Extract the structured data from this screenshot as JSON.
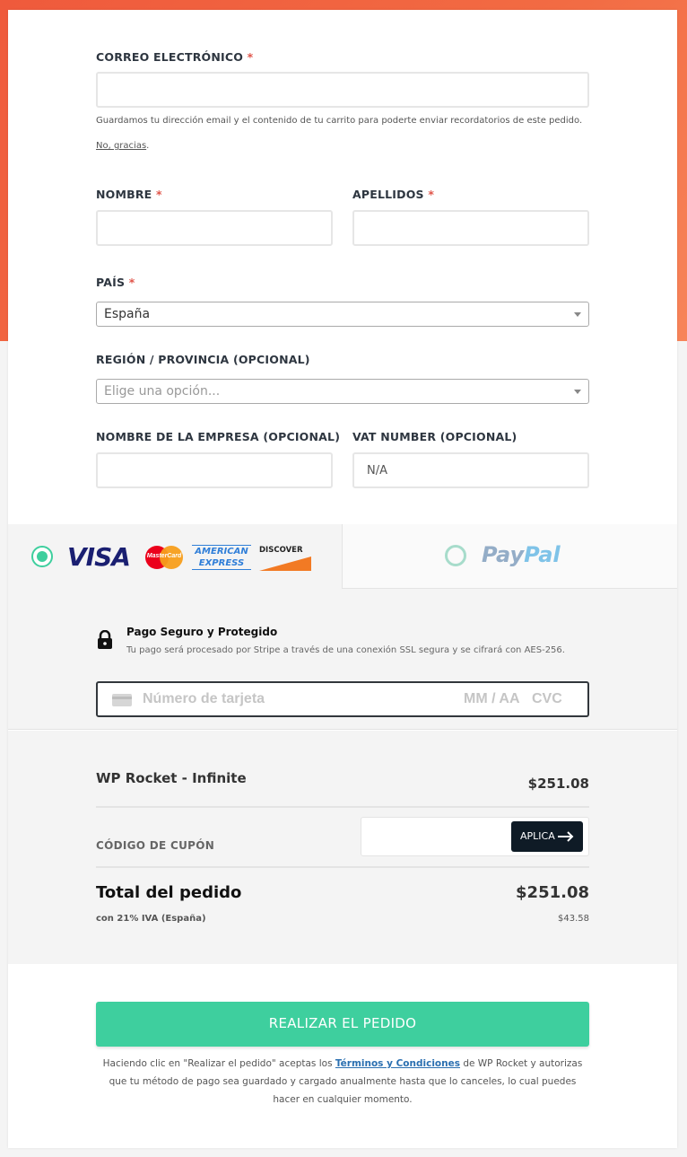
{
  "email": {
    "label": "CORREO ELECTRÓNICO",
    "required_mark": "*",
    "value": "",
    "help": "Guardamos tu dirección email y el contenido de tu carrito para poderte enviar recordatorios de este pedido.",
    "decline_link": "No, gracias",
    "decline_suffix": "."
  },
  "first_name": {
    "label": "NOMBRE",
    "required_mark": "*",
    "value": ""
  },
  "last_name": {
    "label": "APELLIDOS",
    "required_mark": "*",
    "value": ""
  },
  "country": {
    "label": "PAÍS",
    "required_mark": "*",
    "value": "España"
  },
  "region": {
    "label": "REGIÓN / PROVINCIA (OPCIONAL)",
    "placeholder": "Elige una opción..."
  },
  "company": {
    "label": "NOMBRE DE LA EMPRESA (OPCIONAL)",
    "value": ""
  },
  "vat": {
    "label": "VAT NUMBER (OPCIONAL)",
    "value": "N/A"
  },
  "payment": {
    "card_brands": {
      "visa": "VISA",
      "mastercard": "MasterCard",
      "amex_top": "AMERICAN",
      "amex_bottom": "EXPRESS",
      "discover": "DISCOVER"
    },
    "paypal": {
      "pay": "Pay",
      "pal": "Pal"
    },
    "secure_title": "Pago Seguro y Protegido",
    "secure_text": "Tu pago será procesado por Stripe a través de una conexión SSL segura y se cifrará con AES-256.",
    "card_number_placeholder": "Número de tarjeta",
    "card_expiry_placeholder": "MM / AA",
    "card_cvc_placeholder": "CVC",
    "colors": {
      "accent": "#3ecf9e",
      "paypal_dark": "#253b80",
      "paypal_light": "#179bd7"
    }
  },
  "summary": {
    "product_name": "WP Rocket - Infinite",
    "product_price": "$251.08",
    "coupon_label": "CÓDIGO DE CUPÓN",
    "coupon_value": "",
    "coupon_button": "APLICA",
    "total_label": "Total del pedido",
    "total_value": "$251.08",
    "tax_label": "con 21% IVA (España)",
    "tax_value": "$43.58"
  },
  "order": {
    "button_label": "REALIZAR EL PEDIDO",
    "terms_before": "Haciendo clic en \"Realizar el pedido\" aceptas los ",
    "terms_link": "Términos y Condiciones",
    "terms_after": " de WP Rocket y autorizas que tu método de pago sea guardado y cargado anualmente hasta que lo canceles, lo cual puedes hacer en cualquier momento."
  }
}
